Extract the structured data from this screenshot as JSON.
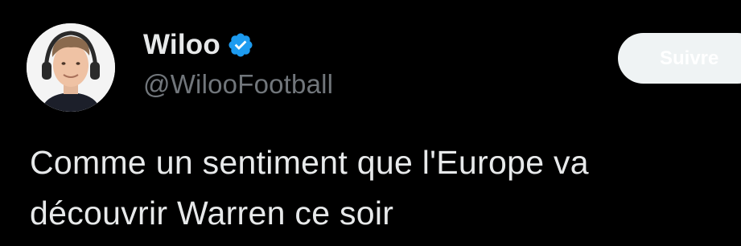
{
  "tweet": {
    "author": {
      "display_name": "Wiloo",
      "handle": "@WilooFootball",
      "verified_icon": "verified-badge-icon",
      "avatar": "avatar-photo"
    },
    "follow_button": {
      "label": "Suivre"
    },
    "text_line_1": "Comme un sentiment que l'Europe va",
    "text_line_2": "découvrir Warren ce soir"
  },
  "colors": {
    "background": "#000000",
    "primary_text": "#e7e9ea",
    "secondary_text": "#71767b",
    "verified_blue": "#1d9bf0",
    "follow_button_bg": "#eff3f4"
  }
}
